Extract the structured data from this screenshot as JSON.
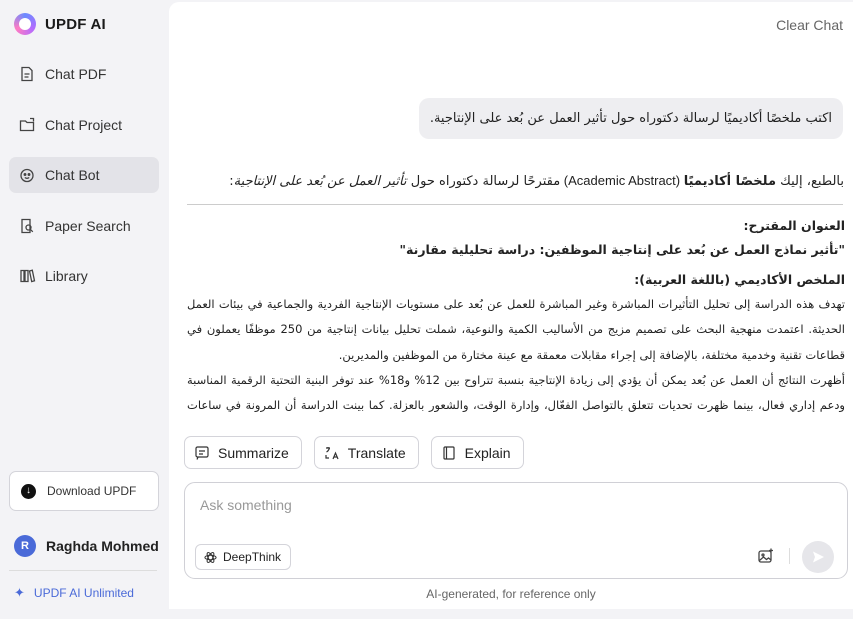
{
  "brand": {
    "name": "UPDF AI"
  },
  "nav": [
    {
      "label": "Chat PDF",
      "icon": "pdf-chat-icon",
      "active": false
    },
    {
      "label": "Chat Project",
      "icon": "folder-chat-icon",
      "active": false
    },
    {
      "label": "Chat Bot",
      "icon": "bot-icon",
      "active": true
    },
    {
      "label": "Paper Search",
      "icon": "paper-search-icon",
      "active": false
    },
    {
      "label": "Library",
      "icon": "library-icon",
      "active": false
    }
  ],
  "download": {
    "label": "Download UPDF"
  },
  "user": {
    "initial": "R",
    "name": "Raghda Mohmed"
  },
  "plan": {
    "label": "UPDF AI Unlimited"
  },
  "header": {
    "clear_label": "Clear Chat"
  },
  "chat": {
    "user_message": "اكتب ملخصًا أكاديميًا لرسالة دكتوراه حول تأثير العمل عن بُعد على الإنتاجية.",
    "intro": {
      "part1": "بالطبع، إليك ",
      "bold": "ملخصًا أكاديميًا",
      "part2": " (Academic Abstract) ",
      "part3": "مقترحًا لرسالة دكتوراه حول ",
      "italic": "تأثير العمل عن بُعد على الإنتاجية",
      "part4": ":"
    },
    "answer": {
      "title_heading": "العنوان المقترح:",
      "title_text": "\"تأثير نماذج العمل عن بُعد على إنتاجية الموظفين: دراسة تحليلية مقارنة\"",
      "abstract_heading": "الملخص الأكاديمي (باللغة العربية):",
      "paragraph1": "تهدف هذه الدراسة إلى تحليل التأثيرات المباشرة وغير المباشرة للعمل عن بُعد على مستويات الإنتاجية الفردية والجماعية في بيئات العمل الحديثة. اعتمدت منهجية البحث على تصميم مزيج من الأساليب الكمية والنوعية، شملت تحليل بيانات إنتاجية من 250 موظفًا يعملون في قطاعات تقنية وخدمية مختلفة، بالإضافة إلى إجراء مقابلات معمقة مع عينة مختارة من الموظفين والمديرين.",
      "paragraph2": "أظهرت النتائج أن العمل عن بُعد يمكن أن يؤدي إلى زيادة الإنتاجية بنسبة تتراوح بين 12% و18% عند توفر البنية التحتية الرقمية المناسبة ودعم إداري فعال، بينما ظهرت تحديات تتعلق بالتواصل الفعّال، وإدارة الوقت، والشعور بالعزلة. كما بينت الدراسة أن المرونة في ساعات العمل"
    }
  },
  "actions": [
    {
      "label": "Summarize",
      "icon": "summarize-icon"
    },
    {
      "label": "Translate",
      "icon": "translate-icon"
    },
    {
      "label": "Explain",
      "icon": "book-icon"
    }
  ],
  "composer": {
    "placeholder": "Ask something",
    "deepthink_label": "DeepThink"
  },
  "footnote": "AI-generated, for reference only",
  "colors": {
    "accent": "#4a6ad8",
    "active_nav": "#e3e3e8",
    "sidebar_bg": "#f3f3f6"
  }
}
